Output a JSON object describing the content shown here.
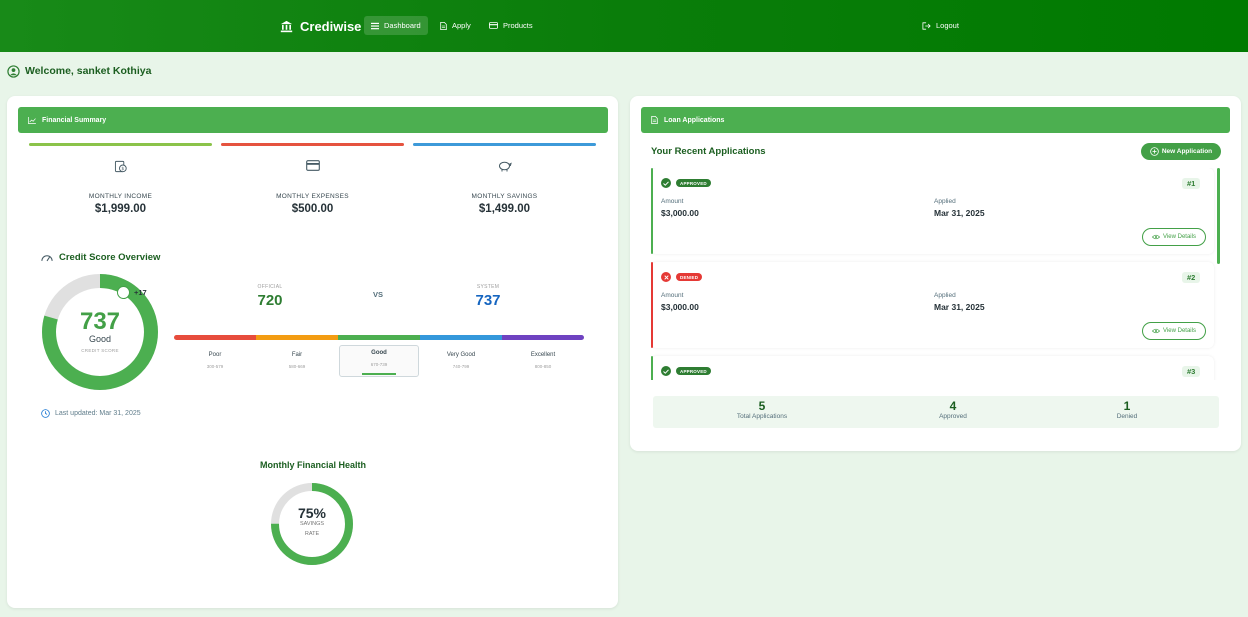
{
  "nav": {
    "brand": "Crediwise",
    "items": [
      {
        "label": "Dashboard",
        "icon": "dashboard-icon",
        "active": true
      },
      {
        "label": "Apply",
        "icon": "document-icon",
        "active": false
      },
      {
        "label": "Products",
        "icon": "card-icon",
        "active": false
      }
    ],
    "logout": "Logout"
  },
  "welcome": "Welcome, sanket Kothiya",
  "summary": {
    "header": "Financial Summary",
    "cards": [
      {
        "label": "MONTHLY INCOME",
        "value": "$1,999.00",
        "icon": "income-icon",
        "color": "#8bc34a"
      },
      {
        "label": "MONTHLY EXPENSES",
        "value": "$500.00",
        "icon": "card-icon",
        "color": "#e5533f"
      },
      {
        "label": "MONTHLY SAVINGS",
        "value": "$1,499.00",
        "icon": "piggy-bank-icon",
        "color": "#3d9ad9"
      }
    ],
    "credit": {
      "title": "Credit Score Overview",
      "score": "737",
      "rating": "Good",
      "caption": "CREDIT SCORE",
      "delta": "+17",
      "official_label": "OFFICIAL",
      "official_value": "720",
      "vs": "VS",
      "system_label": "SYSTEM",
      "system_value": "737",
      "ranges": [
        {
          "name": "Poor",
          "range": "300-579",
          "color": "#e74c3c"
        },
        {
          "name": "Fair",
          "range": "580-669",
          "color": "#f39c12"
        },
        {
          "name": "Good",
          "range": "670-739",
          "color": "#4caf50"
        },
        {
          "name": "Very Good",
          "range": "740-799",
          "color": "#3498db"
        },
        {
          "name": "Excellent",
          "range": "800-850",
          "color": "#6f42c1"
        }
      ],
      "updated": "Last updated: Mar 31, 2025"
    },
    "health": {
      "title": "Monthly Financial Health",
      "pct_text": "75%",
      "cap1": "SAVINGS",
      "cap2": "RATE"
    }
  },
  "chart_data": [
    {
      "type": "gauge",
      "title": "Credit Score Overview",
      "value": 737,
      "min": 300,
      "max": 850
    },
    {
      "type": "pie",
      "title": "Monthly Financial Health",
      "label": "SAVINGS RATE",
      "value": 75,
      "max": 100
    }
  ],
  "loans": {
    "header": "Loan Applications",
    "title": "Your Recent Applications",
    "new_button": "New Application",
    "amount_label": "Amount",
    "applied_label": "Applied",
    "view_label": "View Details",
    "items": [
      {
        "status": "APPROVED",
        "num": "#1",
        "amount": "$3,000.00",
        "applied": "Mar 31, 2025"
      },
      {
        "status": "DENIED",
        "num": "#2",
        "amount": "$3,000.00",
        "applied": "Mar 31, 2025"
      },
      {
        "status": "APPROVED",
        "num": "#3"
      }
    ],
    "stats": [
      {
        "num": "5",
        "label": "Total Applications"
      },
      {
        "num": "4",
        "label": "Approved"
      },
      {
        "num": "1",
        "label": "Denied"
      }
    ]
  },
  "colors": {
    "primary": "#4caf50",
    "dark": "#1b5e20",
    "approved": "#2e7d32",
    "denied": "#e53935"
  }
}
